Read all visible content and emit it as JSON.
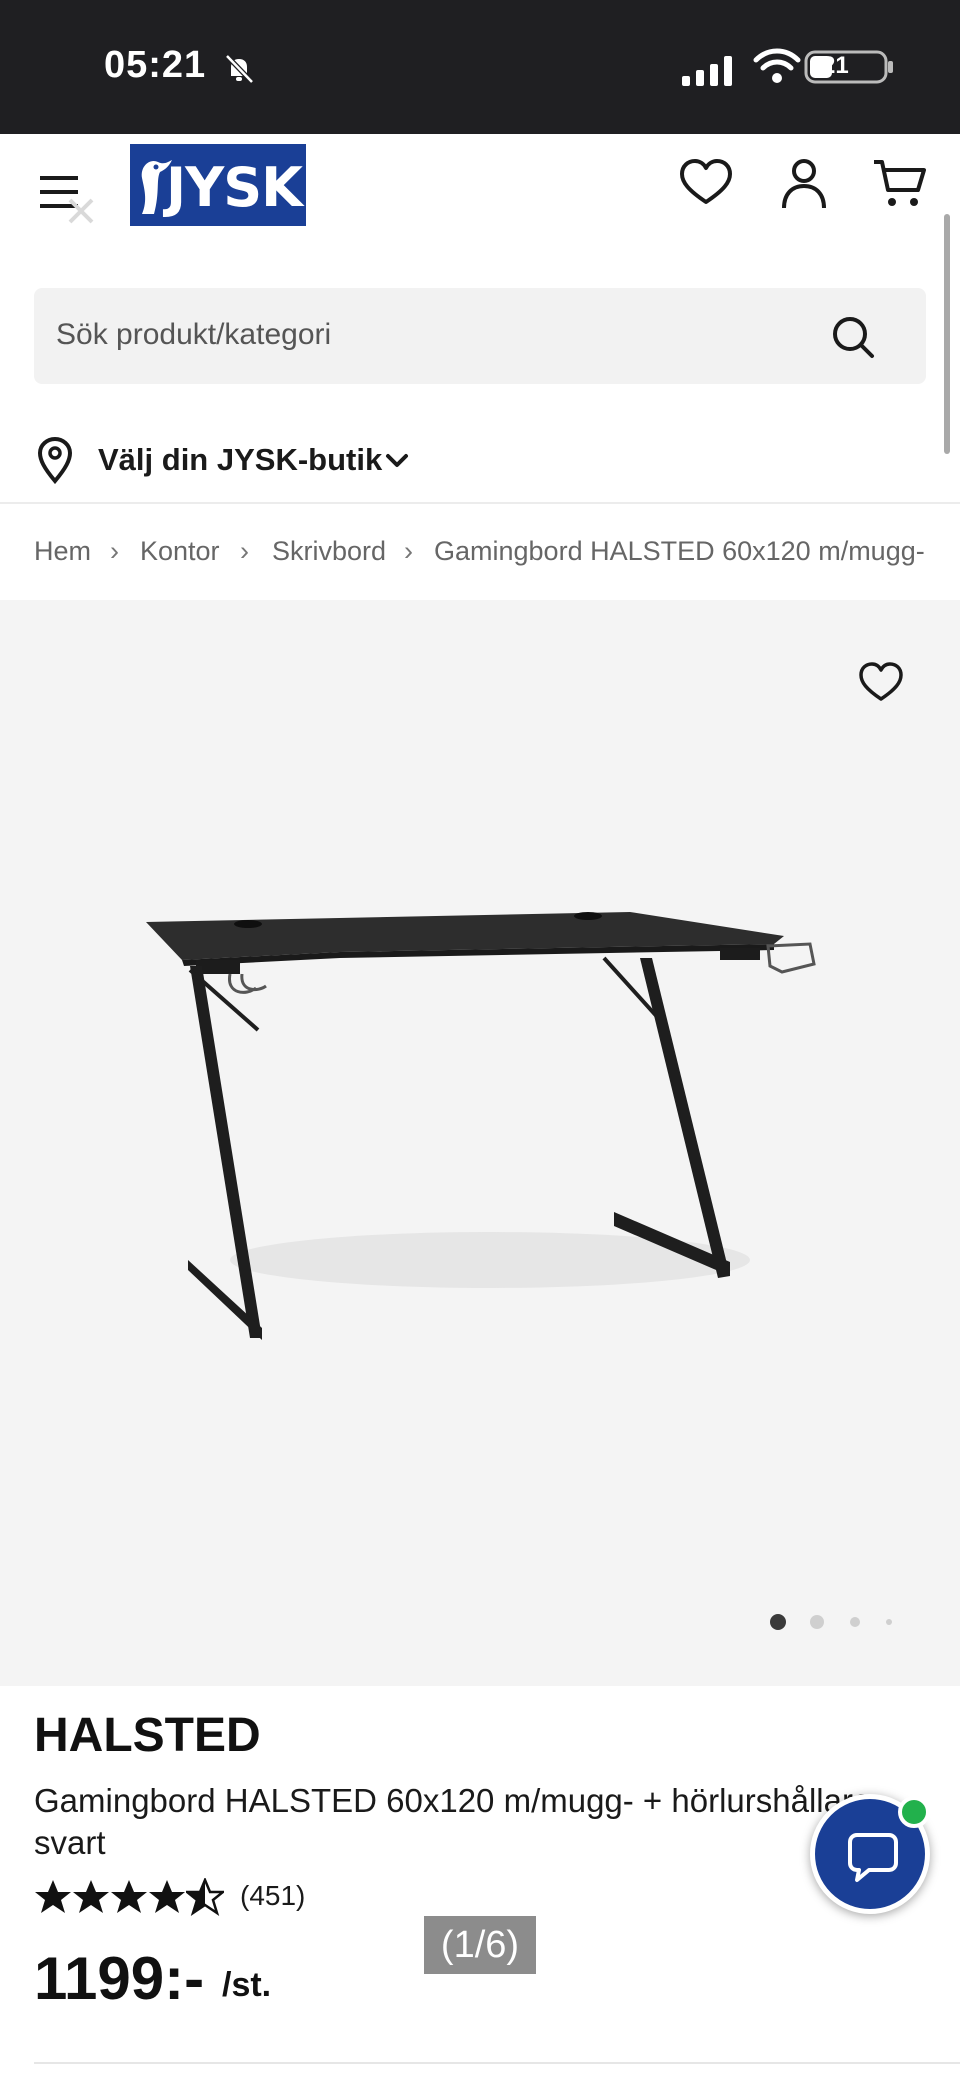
{
  "status_bar": {
    "time": "05:21",
    "battery": "21"
  },
  "header": {
    "logo_text": "JYSK"
  },
  "search": {
    "placeholder": "Sök produkt/kategori"
  },
  "store_selector": {
    "label": "Välj din JYSK-butik"
  },
  "breadcrumb": {
    "items": [
      "Hem",
      "Kontor",
      "Skrivbord",
      "Gamingbord HALSTED 60x120 m/mugg-"
    ]
  },
  "gallery": {
    "image_count": 4,
    "active_index": 0
  },
  "product": {
    "brand": "HALSTED",
    "name": "Gamingbord HALSTED 60x120 m/mugg- + hörlurshållare svart",
    "rating": 4.5,
    "rating_max": 5,
    "rating_count": "(451)",
    "price": "1199:-",
    "price_unit": "/st."
  },
  "page_indicator": "(1/6)",
  "colors": {
    "brand_blue": "#1a3f96",
    "status_bar": "#1f1f22",
    "online_green": "#22b14c"
  },
  "icons": [
    "menu-icon",
    "heart-icon",
    "account-icon",
    "cart-icon",
    "search-icon",
    "location-pin-icon",
    "chevron-down-icon",
    "star-icon",
    "chat-icon"
  ]
}
